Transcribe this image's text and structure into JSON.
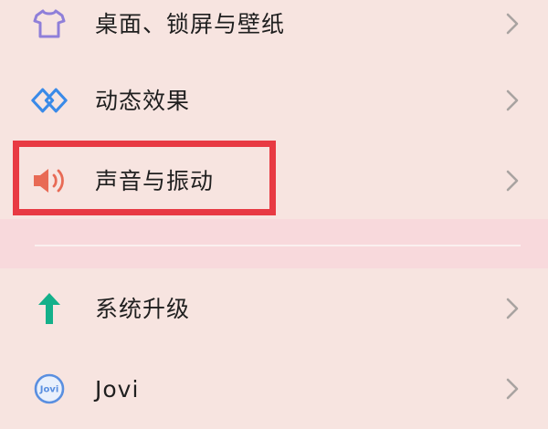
{
  "settings": {
    "items": [
      {
        "label": "桌面、锁屏与壁纸",
        "icon": "tshirt-icon"
      },
      {
        "label": "动态效果",
        "icon": "diamond-layers-icon"
      },
      {
        "label": "声音与振动",
        "icon": "speaker-icon"
      },
      {
        "label": "系统升级",
        "icon": "up-arrow-icon"
      },
      {
        "label": "Jovi",
        "icon": "jovi-icon"
      }
    ],
    "chevron_icon": "chevron-right-icon"
  },
  "annotation": {
    "highlight_color": "#e83a43",
    "highlighted_item": "声音与振动"
  },
  "colors": {
    "background": "#f7e4e0",
    "band": "#f8d9dc",
    "tshirt": "#8f7fd9",
    "diamond": "#3a8ae8",
    "speaker": "#e86a55",
    "arrow": "#14b08a",
    "jovi": "#5a8fe0"
  }
}
